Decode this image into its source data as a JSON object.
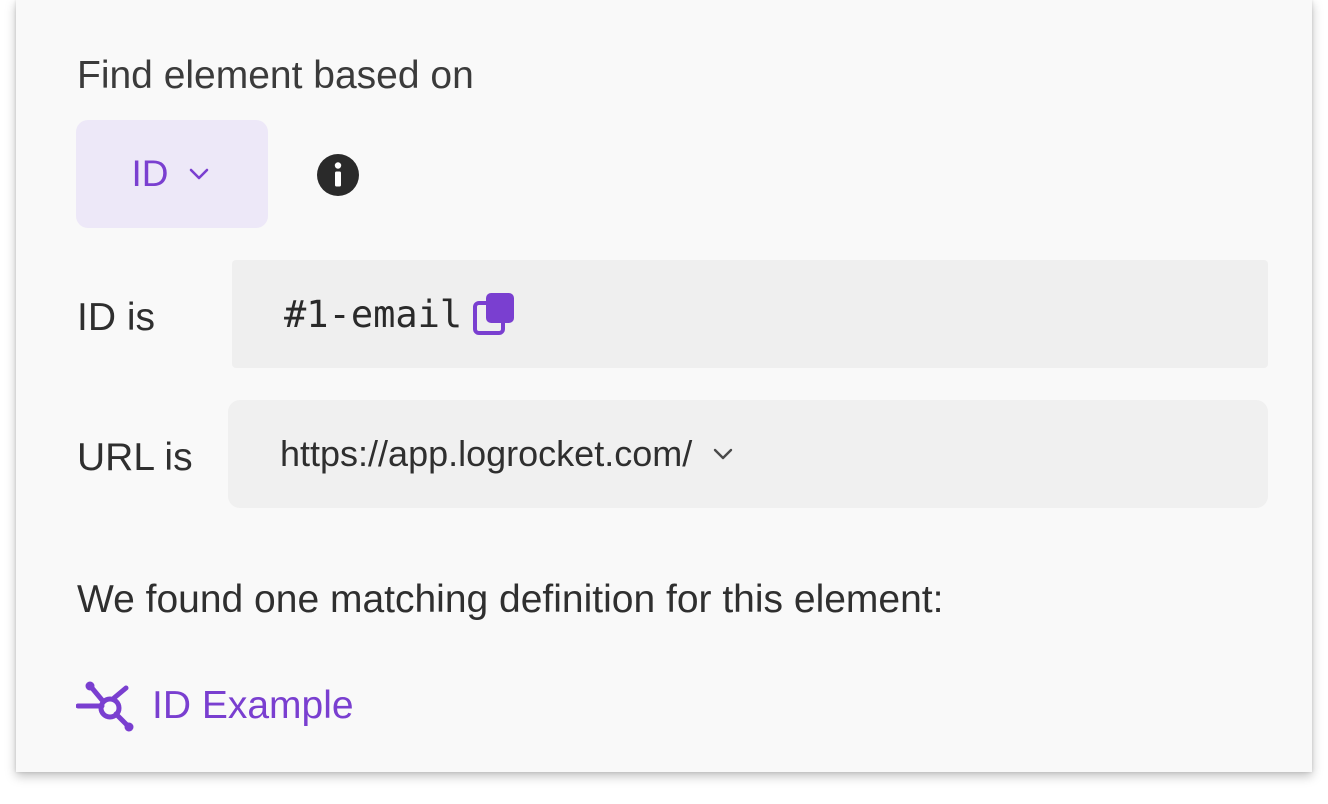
{
  "heading": "Find element based on",
  "selector": {
    "value": "ID",
    "icon": "chevron-down-icon"
  },
  "info": {
    "icon": "info-icon"
  },
  "id_row": {
    "label": "ID is",
    "value": "#1-email",
    "copy_icon": "copy-icon"
  },
  "url_row": {
    "label": "URL is",
    "value": "https://app.logrocket.com/",
    "icon": "chevron-down-icon"
  },
  "result": {
    "text": "We found one matching definition for this element:",
    "definition_label": "ID Example",
    "definition_icon": "definition-node-icon"
  },
  "colors": {
    "accent": "#7a3fd0",
    "accent_bg": "#ede8f8",
    "field_bg": "#efefef",
    "panel_bg": "#f9f9f9",
    "text": "#2f2f2f"
  }
}
